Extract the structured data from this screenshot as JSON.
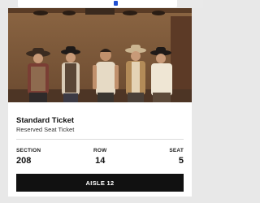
{
  "colors": {
    "background": "#e8e8e8",
    "card": "#ffffff",
    "button_bg": "#111111",
    "button_text": "#ffffff",
    "top_accent": "#1f4fd1"
  },
  "ticket": {
    "title": "Standard Ticket",
    "subtitle": "Reserved Seat Ticket"
  },
  "seat": {
    "section_label": "SECTION",
    "section_value": "208",
    "row_label": "ROW",
    "row_value": "14",
    "seat_label": "SEAT",
    "seat_value": "5"
  },
  "aisle": {
    "label": "AISLE 12"
  }
}
